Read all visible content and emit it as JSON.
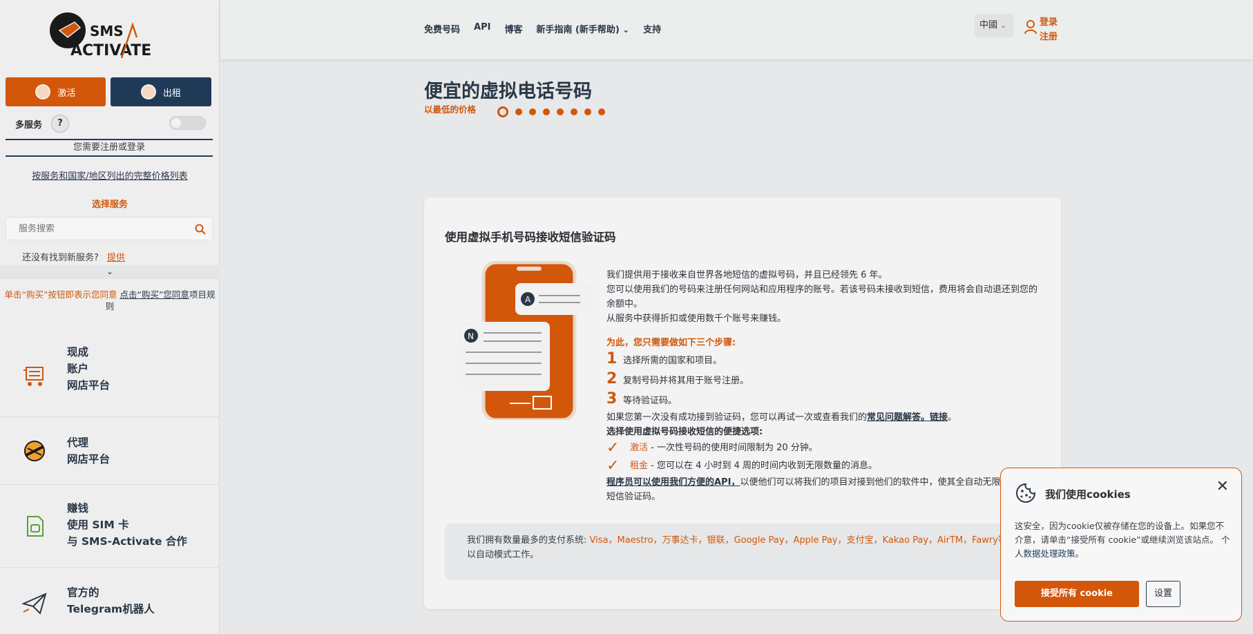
{
  "logo": {
    "line1": "SMS",
    "line2": "ACTIVATE"
  },
  "sidebar": {
    "activate_label": "激活",
    "rent_label": "出租",
    "multi_service": "多服务",
    "help": "?",
    "need_login": "您需要注册或登录",
    "price_list": "按服务和国家/地区列出的完整价格列表",
    "choose_service": "选择服务",
    "search_placeholder": "服务搜索",
    "not_found": "还没有找到新服务?",
    "offer": "提供",
    "expand": "⌄",
    "agree_prefix": "单击“购买”按钮即表示您同意",
    "agree_link": "点击“购买”您同意",
    "agree_suffix": "项目规则",
    "promos": [
      {
        "l1": "现成",
        "l2": "账户",
        "l3": "网店平台"
      },
      {
        "l1": "代理",
        "l2": "网店平台"
      },
      {
        "l1": "赚钱",
        "l2": "使用 SIM 卡",
        "l3": "与 SMS-Activate 合作"
      },
      {
        "l1": "官方的",
        "l2": "Telegram机器人"
      }
    ]
  },
  "header": {
    "nav": [
      "免费号码",
      "API",
      "博客",
      "新手指南 (新手帮助)",
      "支持"
    ],
    "lang": "中國",
    "login": "登录",
    "register": "注册"
  },
  "hero": {
    "title": "便宜的虚拟电话号码",
    "subtitle": "以最低的价格",
    "slides": 8,
    "active_slide": 1
  },
  "card": {
    "title": "使用虚拟手机号码接收短信验证码",
    "p1": "我们提供用于接收来自世界各地短信的虚拟号码，并且已经领先 6 年。",
    "p2": "您可以使用我们的号码来注册任何网站和应用程序的账号。若该号码未接收到短信，费用将会自动退还到您的余额中。",
    "p3": "从服务中获得折扣或使用数千个账号来赚钱。",
    "steps_title": "为此，您只需要做如下三个步骤:",
    "steps": [
      {
        "n": "1",
        "text": "选择所需的国家和项目。"
      },
      {
        "n": "2",
        "text": "复制号码并将其用于账号注册。"
      },
      {
        "n": "3",
        "text": "等待验证码。"
      }
    ],
    "retry_prefix": "如果您第一次没有成功接到验证码，您可以再试一次或查看我们的",
    "retry_link": "常见问题解答。链接",
    "retry_suffix": "。",
    "options_title": "选择使用虚拟号码接收短信的便捷选项:",
    "opt1_name": "激活",
    "opt1_text": " - 一次性号码的使用时间限制为 20 分钟。",
    "opt2_name": "租金",
    "opt2_text": " - 您可以在 4 小时到 4 周的时间内收到无限数量的消息。",
    "api_link": "程序员可以使用我们方便的API，",
    "api_text": "以便他们可以将我们的项目对接到他们的软件中，使其全自动无限制地接收短信验证码。",
    "pay_prefix": "我们拥有数量最多的支付系统:",
    "pay_methods": "Visa，Maestro，万事达卡，银联，Google Pay，Apple Pay，支付宝，Kakao Pay，AirTM，Fawry等",
    "pay_suffix": "，以自动模式工作。"
  },
  "cookie": {
    "title": "我们使用cookies",
    "text": "这安全，因为cookie仅被存储在您的设备上。如果您不介意，请单击“接受所有 cookie”或继续浏览该站点。",
    "policy_link": "个人数据处理政策。",
    "accept": "接受所有 cookie",
    "settings": "设置"
  },
  "colors": {
    "accent": "#d2570a",
    "navy": "#1f3a57"
  }
}
